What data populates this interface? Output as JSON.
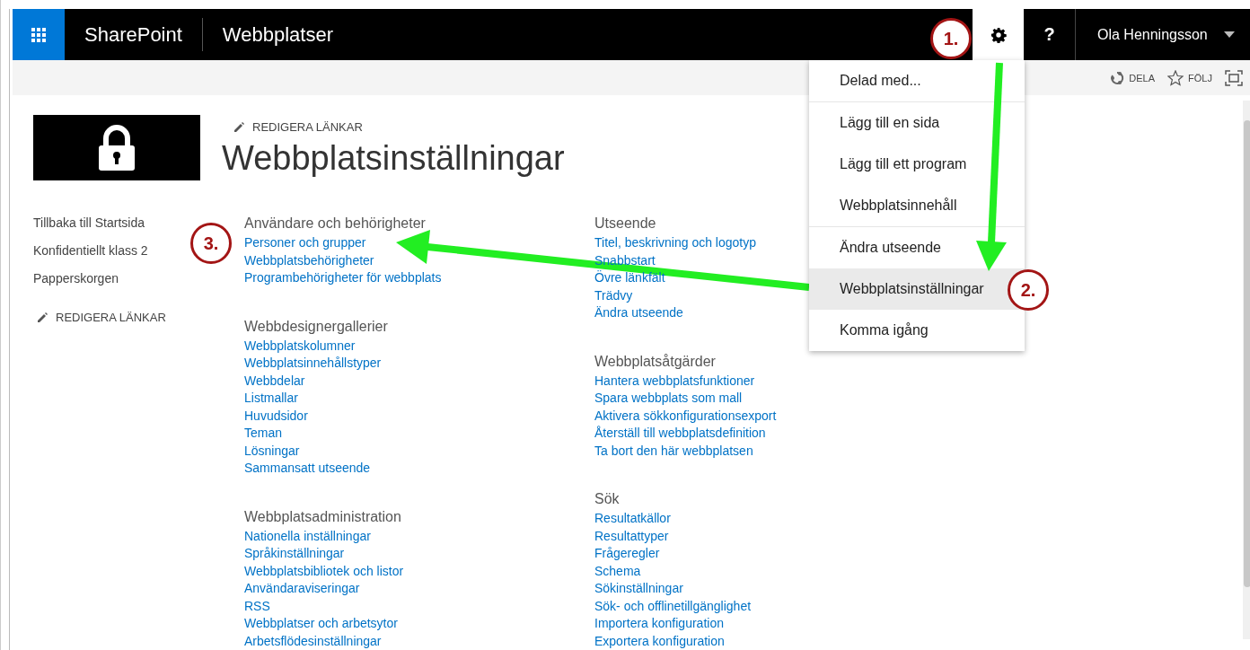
{
  "suite_bar": {
    "app_name": "SharePoint",
    "site_title": "Webbplatser",
    "help": "?",
    "user_name": "Ola Henningsson",
    "settings_open": true
  },
  "ribbon": {
    "actions": [
      {
        "kind": "share",
        "label": "DELA"
      },
      {
        "kind": "follow",
        "label": "FÖLJ"
      },
      {
        "kind": "focus"
      }
    ]
  },
  "header": {
    "edit_links": "REDIGERA LÄNKAR",
    "page_title": "Webbplatsinställningar"
  },
  "left_nav": {
    "items": [
      "Tillbaka till Startsida",
      "Konfidentiellt klass 2",
      "Papperskorgen"
    ],
    "edit_links": "REDIGERA LÄNKAR"
  },
  "columns": [
    [
      {
        "heading": "Användare och behörigheter",
        "links": [
          "Personer och grupper",
          "Webbplatsbehörigheter",
          "Programbehörigheter för webbplats"
        ]
      },
      {
        "heading": "Webbdesignergallerier",
        "links": [
          "Webbplatskolumner",
          "Webbplatsinnehållstyper",
          "Webbdelar",
          "Listmallar",
          "Huvudsidor",
          "Teman",
          "Lösningar",
          "Sammansatt utseende"
        ]
      },
      {
        "heading": "Webbplatsadministration",
        "links": [
          "Nationella inställningar",
          "Språkinställningar",
          "Webbplatsbibliotek och listor",
          "Användaraviseringar",
          "RSS",
          "Webbplatser och arbetsytor",
          "Arbetsflödesinställningar"
        ]
      }
    ],
    [
      {
        "heading": "Utseende",
        "links": [
          "Titel, beskrivning och logotyp",
          "Snabbstart",
          "Övre länkfält",
          "Trädvy",
          "Ändra utseende"
        ]
      },
      {
        "heading": "Webbplatsåtgärder",
        "links": [
          "Hantera webbplatsfunktioner",
          "Spara webbplats som mall",
          "Aktivera sökkonfigurationsexport",
          "Återställ till webbplatsdefinition",
          "Ta bort den här webbplatsen"
        ]
      },
      {
        "heading": "Sök",
        "links": [
          "Resultatkällor",
          "Resultattyper",
          "Frågeregler",
          "Schema",
          "Sökinställningar",
          "Sök- och offlinetillgänglighet",
          "Importera konfiguration",
          "Exportera konfiguration"
        ]
      }
    ]
  ],
  "settings_menu": {
    "groups": [
      [
        {
          "label": "Delad med...",
          "selected": false
        }
      ],
      [
        {
          "label": "Lägg till en sida",
          "selected": false
        },
        {
          "label": "Lägg till ett program",
          "selected": false
        },
        {
          "label": "Webbplatsinnehåll",
          "selected": false
        }
      ],
      [
        {
          "label": "Ändra utseende",
          "selected": false
        },
        {
          "label": "Webbplatsinställningar",
          "selected": true
        },
        {
          "label": "Komma igång",
          "selected": false
        }
      ]
    ]
  },
  "annotations": [
    {
      "label": "1."
    },
    {
      "label": "2."
    },
    {
      "label": "3."
    }
  ]
}
